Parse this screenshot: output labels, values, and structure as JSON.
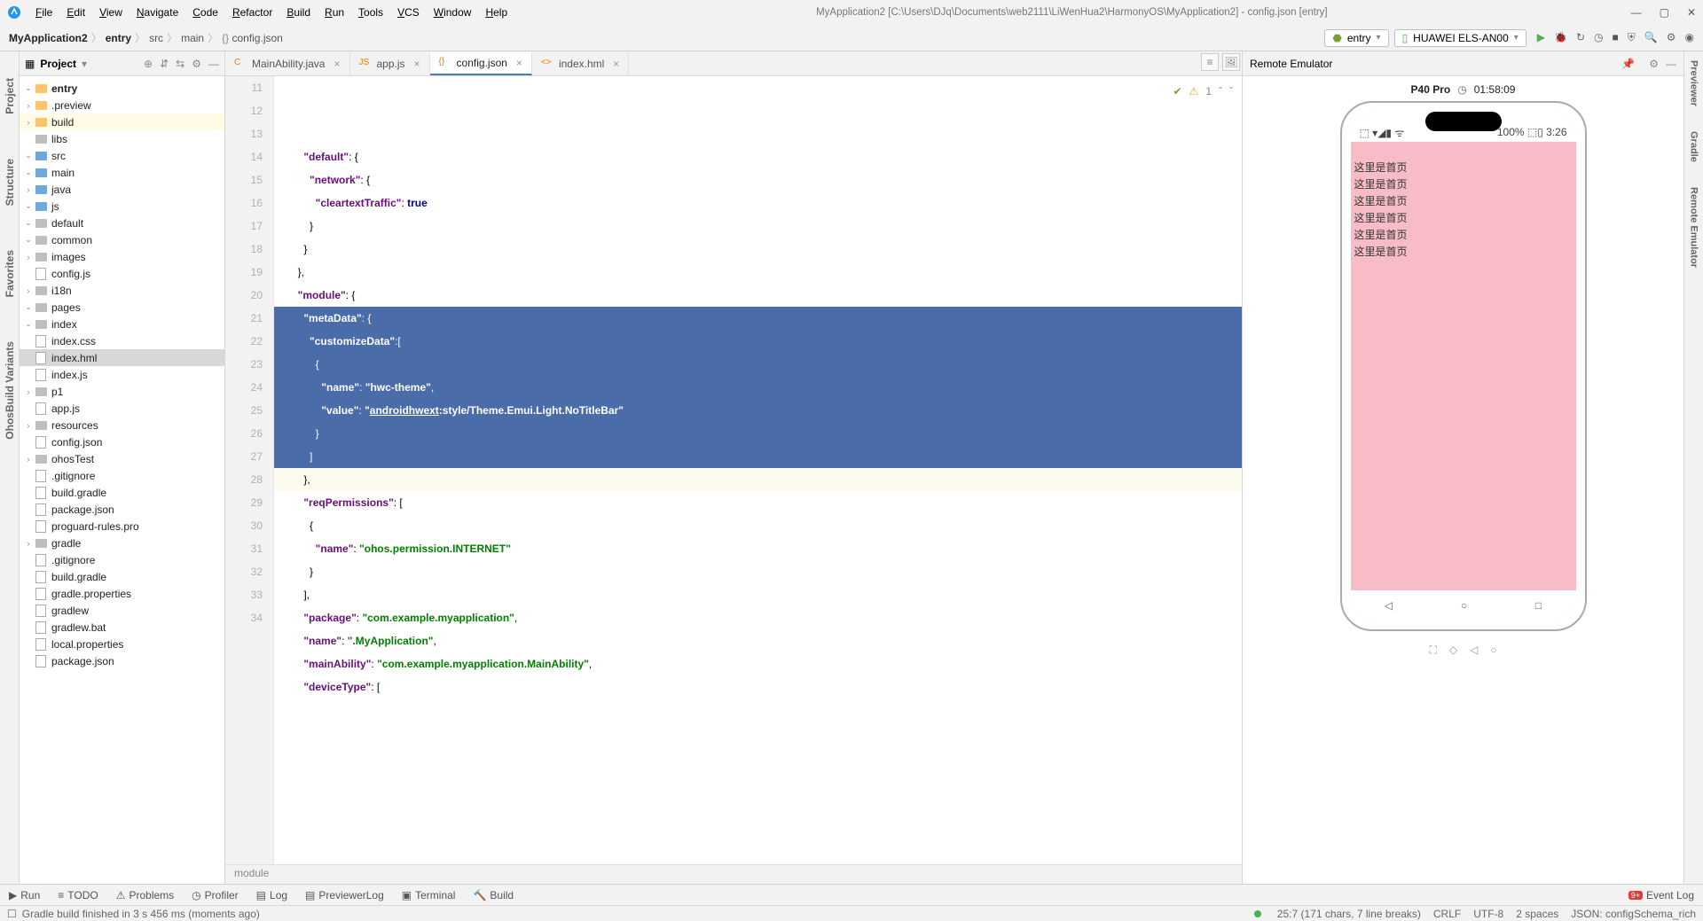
{
  "menubar": [
    "File",
    "Edit",
    "View",
    "Navigate",
    "Code",
    "Refactor",
    "Build",
    "Run",
    "Tools",
    "VCS",
    "Window",
    "Help"
  ],
  "window_title": "MyApplication2 [C:\\Users\\DJq\\Documents\\web2111\\LiWenHua2\\HarmonyOS\\MyApplication2] - config.json [entry]",
  "breadcrumb": [
    "MyApplication2",
    "entry",
    "src",
    "main",
    "config.json"
  ],
  "combo_entry": "entry",
  "combo_device": "HUAWEI ELS-AN00",
  "project_label": "Project",
  "tree": [
    {
      "d": 0,
      "c": "v",
      "t": "entry",
      "fold": "o",
      "bold": true
    },
    {
      "d": 1,
      "c": ">",
      "t": ".preview",
      "fold": "o"
    },
    {
      "d": 1,
      "c": ">",
      "t": "build",
      "fold": "o",
      "hl": true
    },
    {
      "d": 1,
      "c": "",
      "t": "libs",
      "fold": "g"
    },
    {
      "d": 1,
      "c": "v",
      "t": "src",
      "fold": "b"
    },
    {
      "d": 2,
      "c": "v",
      "t": "main",
      "fold": "b"
    },
    {
      "d": 3,
      "c": ">",
      "t": "java",
      "fold": "b"
    },
    {
      "d": 3,
      "c": "v",
      "t": "js",
      "fold": "b"
    },
    {
      "d": 4,
      "c": "v",
      "t": "default",
      "fold": "g"
    },
    {
      "d": 5,
      "c": "v",
      "t": "common",
      "fold": "g"
    },
    {
      "d": 6,
      "c": ">",
      "t": "images",
      "fold": "g"
    },
    {
      "d": 6,
      "c": "",
      "t": "config.js",
      "file": "js"
    },
    {
      "d": 5,
      "c": ">",
      "t": "i18n",
      "fold": "g"
    },
    {
      "d": 5,
      "c": "v",
      "t": "pages",
      "fold": "g"
    },
    {
      "d": 6,
      "c": "v",
      "t": "index",
      "fold": "g"
    },
    {
      "d": 7,
      "c": "",
      "t": "index.css",
      "file": "css"
    },
    {
      "d": 7,
      "c": "",
      "t": "index.hml",
      "file": "hml",
      "sel": true
    },
    {
      "d": 7,
      "c": "",
      "t": "index.js",
      "file": "js"
    },
    {
      "d": 6,
      "c": ">",
      "t": "p1",
      "fold": "g"
    },
    {
      "d": 5,
      "c": "",
      "t": "app.js",
      "file": "js"
    },
    {
      "d": 3,
      "c": ">",
      "t": "resources",
      "fold": "g"
    },
    {
      "d": 3,
      "c": "",
      "t": "config.json",
      "file": "json"
    },
    {
      "d": 2,
      "c": ">",
      "t": "ohosTest",
      "fold": "g"
    },
    {
      "d": 1,
      "c": "",
      "t": ".gitignore",
      "file": "f"
    },
    {
      "d": 1,
      "c": "",
      "t": "build.gradle",
      "file": "f"
    },
    {
      "d": 1,
      "c": "",
      "t": "package.json",
      "file": "json"
    },
    {
      "d": 1,
      "c": "",
      "t": "proguard-rules.pro",
      "file": "f"
    },
    {
      "d": 0,
      "c": ">",
      "t": "gradle",
      "fold": "g"
    },
    {
      "d": 0,
      "c": "",
      "t": ".gitignore",
      "file": "f"
    },
    {
      "d": 0,
      "c": "",
      "t": "build.gradle",
      "file": "f"
    },
    {
      "d": 0,
      "c": "",
      "t": "gradle.properties",
      "file": "f"
    },
    {
      "d": 0,
      "c": "",
      "t": "gradlew",
      "file": "f"
    },
    {
      "d": 0,
      "c": "",
      "t": "gradlew.bat",
      "file": "f"
    },
    {
      "d": 0,
      "c": "",
      "t": "local.properties",
      "file": "f"
    },
    {
      "d": 0,
      "c": "",
      "t": "package.json",
      "file": "json"
    }
  ],
  "tabs": [
    {
      "label": "MainAbility.java",
      "icon": "C"
    },
    {
      "label": "app.js",
      "icon": "JS"
    },
    {
      "label": "config.json",
      "icon": "{}",
      "active": true
    },
    {
      "label": "index.hml",
      "icon": "<>"
    }
  ],
  "lines": [
    {
      "n": 11,
      "html": "    <span class='k'>\"default\"</span>: {"
    },
    {
      "n": 12,
      "html": "      <span class='k'>\"network\"</span>: {"
    },
    {
      "n": 13,
      "html": "        <span class='k'>\"cleartextTraffic\"</span>: <span class='v'>true</span>"
    },
    {
      "n": 14,
      "html": "      }"
    },
    {
      "n": 15,
      "html": "    }"
    },
    {
      "n": 16,
      "html": "  },"
    },
    {
      "n": 17,
      "html": "  <span class='k'>\"module\"</span>: {"
    },
    {
      "n": 18,
      "html": "    <span class='k'>\"metaData\"</span>: {",
      "sel": true
    },
    {
      "n": 19,
      "html": "      <span class='k'>\"customizeData\"</span>:[",
      "sel": true
    },
    {
      "n": 20,
      "html": "        {",
      "sel": true
    },
    {
      "n": 21,
      "html": "          <span class='k'>\"name\"</span>: <span class='s'>\"hwc-theme\"</span>,",
      "sel": true
    },
    {
      "n": 22,
      "html": "          <span class='k'>\"value\"</span>: <span class='s'>\"<u>androidhwext</u>:style/Theme.Emui.Light.NoTitleBar\"</span>",
      "sel": true
    },
    {
      "n": 23,
      "html": "        }",
      "sel": true
    },
    {
      "n": 24,
      "html": "      ]",
      "sel": true
    },
    {
      "n": 25,
      "html": "    },",
      "cur": true,
      "bullet": true
    },
    {
      "n": 26,
      "html": "    <span class='k'>\"reqPermissions\"</span>: ["
    },
    {
      "n": 27,
      "html": "      {"
    },
    {
      "n": 28,
      "html": "        <span class='k'>\"name\"</span>: <span class='s'>\"ohos.permission.INTERNET\"</span>"
    },
    {
      "n": 29,
      "html": "      }"
    },
    {
      "n": 30,
      "html": "    ],"
    },
    {
      "n": 31,
      "html": "    <span class='k'>\"package\"</span>: <span class='s'>\"com.example.myapplication\"</span>,"
    },
    {
      "n": 32,
      "html": "    <span class='k'>\"name\"</span>: <span class='s'>\".MyApplication\"</span>,"
    },
    {
      "n": 33,
      "html": "    <span class='k'>\"mainAbility\"</span>: <span class='s'>\"com.example.myapplication.MainAbility\"</span>,"
    },
    {
      "n": 34,
      "html": "    <span class='k'>\"deviceType\"</span>: ["
    }
  ],
  "editor_crumb": "module",
  "warn_count": "1",
  "emulator_title": "Remote Emulator",
  "device_name": "P40 Pro",
  "device_timer": "01:58:09",
  "sb_left": "⬚ ▾◢▮ ᯤ",
  "sb_right": "100% ⬚▯ 3:26",
  "screen_text": "这里是首页",
  "screen_repeat": 6,
  "left_tools": [
    "Project",
    "Structure",
    "Favorites",
    "OhosBuild Variants"
  ],
  "right_tools": [
    "Previewer",
    "Gradle",
    "Remote Emulator"
  ],
  "bottom_tools": [
    "Run",
    "TODO",
    "Problems",
    "Profiler",
    "Log",
    "PreviewerLog",
    "Terminal",
    "Build"
  ],
  "event_log": "Event Log",
  "status_msg": "Gradle build finished in 3 s 456 ms (moments ago)",
  "status_right": [
    "25:7 (171 chars, 7 line breaks)",
    "CRLF",
    "UTF-8",
    "2 spaces",
    "JSON: configSchema_rich"
  ]
}
